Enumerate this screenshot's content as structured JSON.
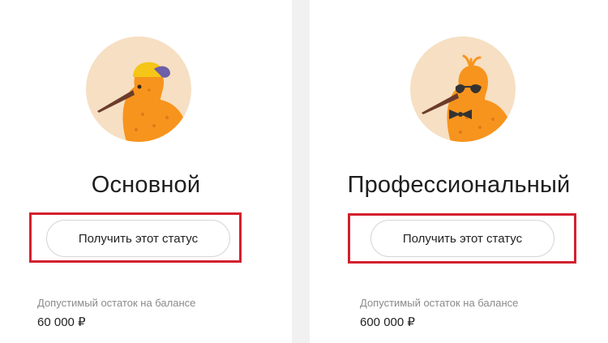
{
  "cards": [
    {
      "title": "Основной",
      "button_label": "Получить этот статус",
      "balance_label": "Допустимый остаток на балансе",
      "balance_value": "60 000 ₽",
      "avatar_icon": "kiwi-bird-cap-icon"
    },
    {
      "title": "Профессиональный",
      "button_label": "Получить этот статус",
      "balance_label": "Допустимый остаток на балансе",
      "balance_value": "600 000 ₽",
      "avatar_icon": "kiwi-bird-sunglasses-bowtie-icon"
    }
  ],
  "colors": {
    "highlight": "#d3202f",
    "avatar_bg": "#f6dfc3",
    "bird": "#f7941d",
    "divider": "#f1f1f1"
  }
}
